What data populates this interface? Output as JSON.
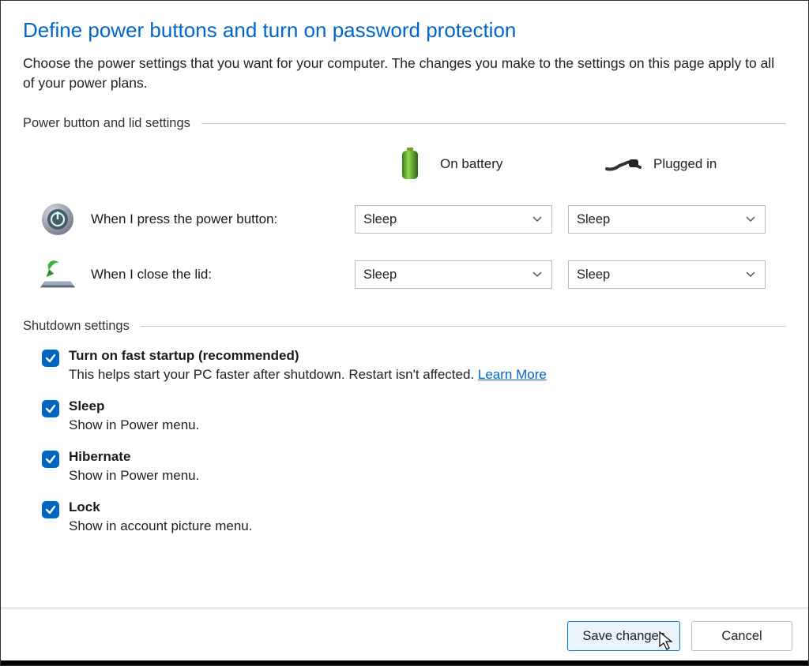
{
  "header": {
    "title": "Define power buttons and turn on password protection",
    "description": "Choose the power settings that you want for your computer. The changes you make to the settings on this page apply to all of your power plans."
  },
  "power_section": {
    "title": "Power button and lid settings",
    "col_battery": "On battery",
    "col_plugged": "Plugged in",
    "rows": {
      "power_button": {
        "label": "When I press the power button:",
        "battery_value": "Sleep",
        "plugged_value": "Sleep"
      },
      "lid": {
        "label": "When I close the lid:",
        "battery_value": "Sleep",
        "plugged_value": "Sleep"
      }
    }
  },
  "shutdown_section": {
    "title": "Shutdown settings",
    "items": {
      "fast_startup": {
        "checked": true,
        "title": "Turn on fast startup (recommended)",
        "sub": "This helps start your PC faster after shutdown. Restart isn't affected. ",
        "link": "Learn More"
      },
      "sleep": {
        "checked": true,
        "title": "Sleep",
        "sub": "Show in Power menu."
      },
      "hibernate": {
        "checked": true,
        "title": "Hibernate",
        "sub": "Show in Power menu."
      },
      "lock": {
        "checked": true,
        "title": "Lock",
        "sub": "Show in account picture menu."
      }
    }
  },
  "footer": {
    "save": "Save changes",
    "cancel": "Cancel"
  }
}
